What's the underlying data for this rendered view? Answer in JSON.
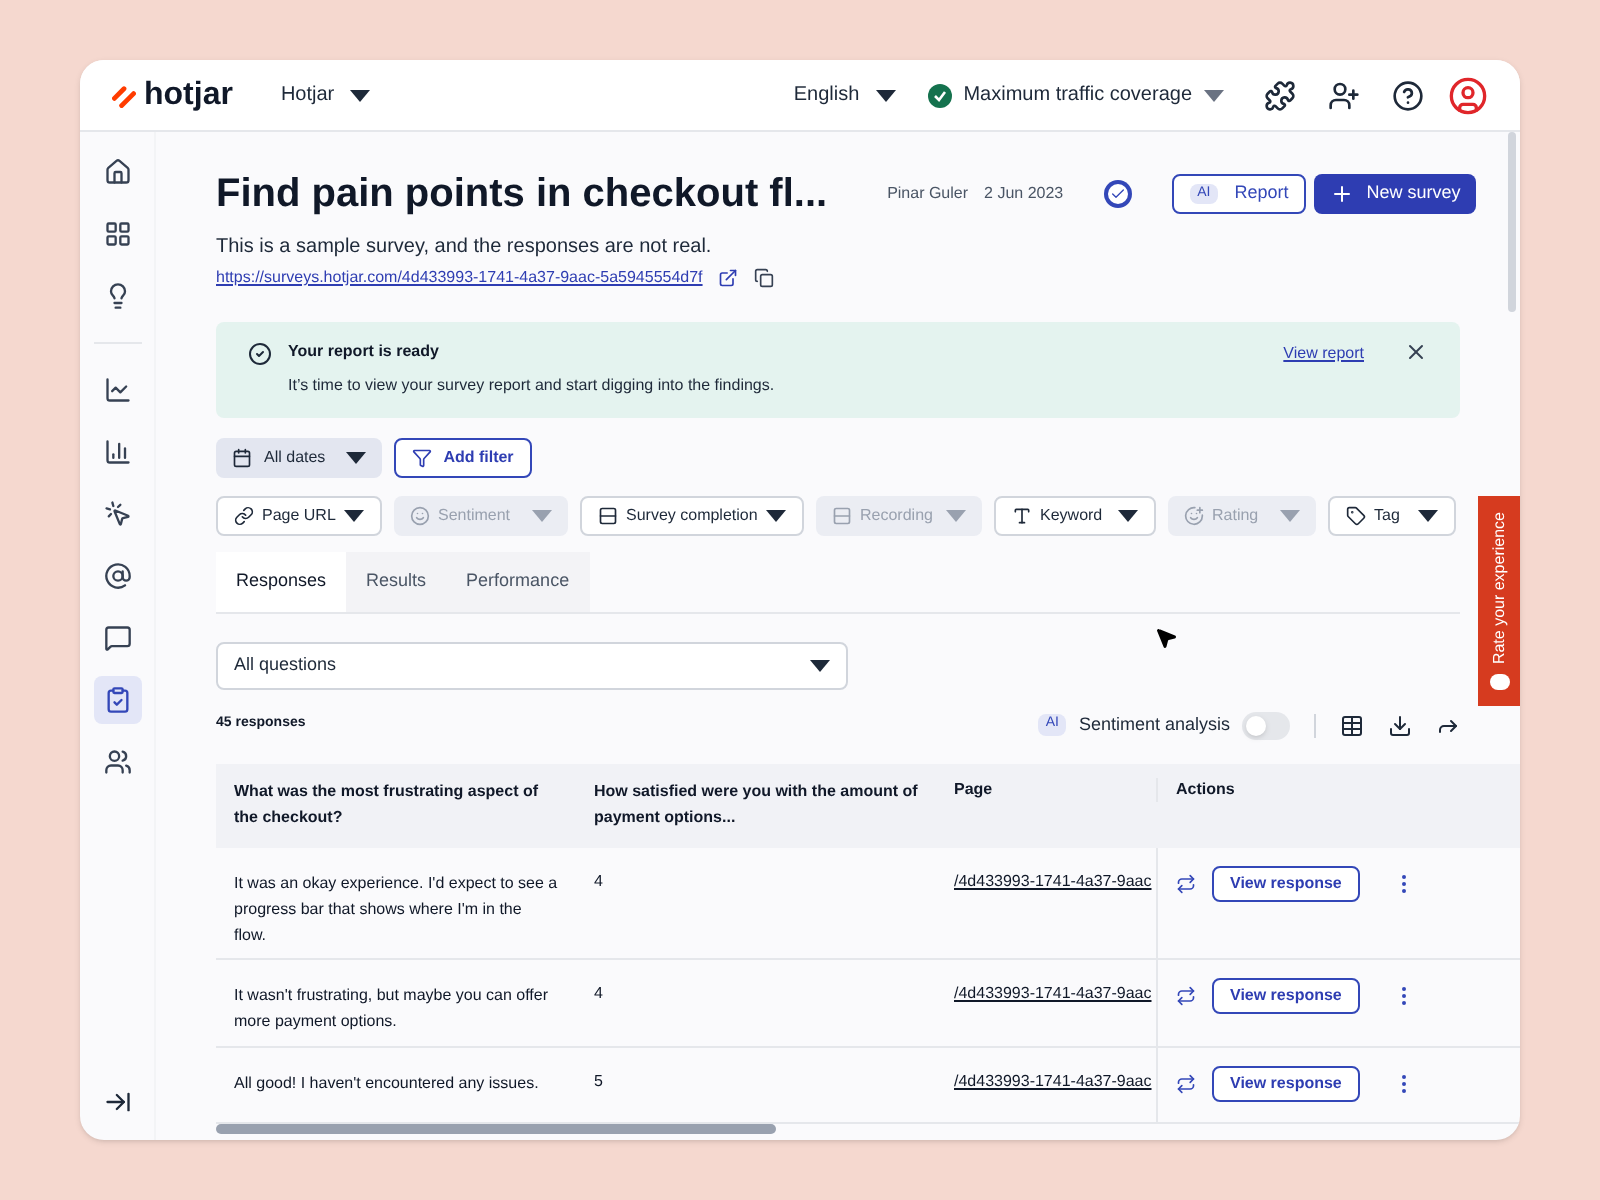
{
  "topbar": {
    "logo": "hotjar",
    "site": "Hotjar",
    "language": "English",
    "coverage": "Maximum traffic coverage"
  },
  "sidebar": {
    "items": [
      {
        "kind": "home",
        "selected": false
      },
      {
        "kind": "grid",
        "selected": false
      },
      {
        "kind": "bulb",
        "selected": false
      },
      {
        "kind": "trend",
        "selected": false
      },
      {
        "kind": "bars",
        "selected": false
      },
      {
        "kind": "click",
        "selected": false
      },
      {
        "kind": "at",
        "selected": false
      },
      {
        "kind": "chat",
        "selected": false
      },
      {
        "kind": "survey",
        "selected": true
      },
      {
        "kind": "users",
        "selected": false
      }
    ]
  },
  "header": {
    "title": "Find pain points in checkout fl...",
    "author": "Pinar Guler",
    "date": "2 Jun 2023",
    "active": true,
    "ai_badge": "AI",
    "report_button": "Report",
    "new_button": "New survey",
    "description": "This is a sample survey, and the responses are not real.",
    "url": "https://surveys.hotjar.com/4d433993-1741-4a37-9aac-5a5945554d7f"
  },
  "banner": {
    "title": "Your report is ready",
    "text": "It’s time to view your survey report and start digging into the findings.",
    "link": "View report"
  },
  "date_filter": "All dates",
  "add_filter": "Add filter",
  "filters": [
    {
      "kind": "link",
      "label": "Page URL",
      "disabled": false
    },
    {
      "kind": "smile",
      "label": "Sentiment",
      "disabled": true
    },
    {
      "kind": "rows",
      "label": "Survey completion",
      "disabled": false
    },
    {
      "kind": "rows",
      "label": "Recording",
      "disabled": true
    },
    {
      "kind": "letter",
      "label": "Keyword",
      "disabled": false
    },
    {
      "kind": "rating",
      "label": "Rating",
      "disabled": true
    },
    {
      "kind": "tag",
      "label": "Tag",
      "disabled": false
    }
  ],
  "tabs": [
    {
      "label": "Responses",
      "selected": true
    },
    {
      "label": "Results",
      "selected": false
    },
    {
      "label": "Performance",
      "selected": false
    }
  ],
  "question_select": "All questions",
  "response_count": "45 responses",
  "sentiment": {
    "ai_badge": "AI",
    "label": "Sentiment analysis",
    "on": false
  },
  "table": {
    "columns": [
      "What was the most frustrating aspect of the checkout?",
      "How satisfied were you with the amount of payment options...",
      "Page",
      "Actions"
    ],
    "rows": [
      {
        "answer": "It was an okay experience. I'd expect to see a progress bar that shows where I'm in the flow.",
        "rating": "4",
        "page": "/4d433993-1741-4a37-9aac",
        "action": "View response"
      },
      {
        "answer": "It wasn't frustrating, but maybe you can offer more payment options.",
        "rating": "4",
        "page": "/4d433993-1741-4a37-9aac",
        "action": "View response"
      },
      {
        "answer": "All good! I haven't encountered any issues.",
        "rating": "5",
        "page": "/4d433993-1741-4a37-9aac",
        "action": "View response"
      }
    ]
  },
  "feedback_tab": "Rate your experience"
}
